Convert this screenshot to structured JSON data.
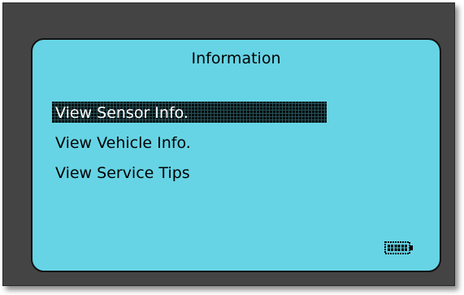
{
  "screen": {
    "title": "Information",
    "menu": {
      "items": [
        {
          "label": "View Sensor Info.",
          "selected": true
        },
        {
          "label": "View Vehicle Info.",
          "selected": false
        },
        {
          "label": "View Service Tips",
          "selected": false
        }
      ]
    },
    "battery_icon": "battery-full-icon",
    "colors": {
      "screen_bg": "#66d4e5",
      "bezel": "#444444",
      "text": "#000000",
      "highlight": "#000000"
    }
  }
}
